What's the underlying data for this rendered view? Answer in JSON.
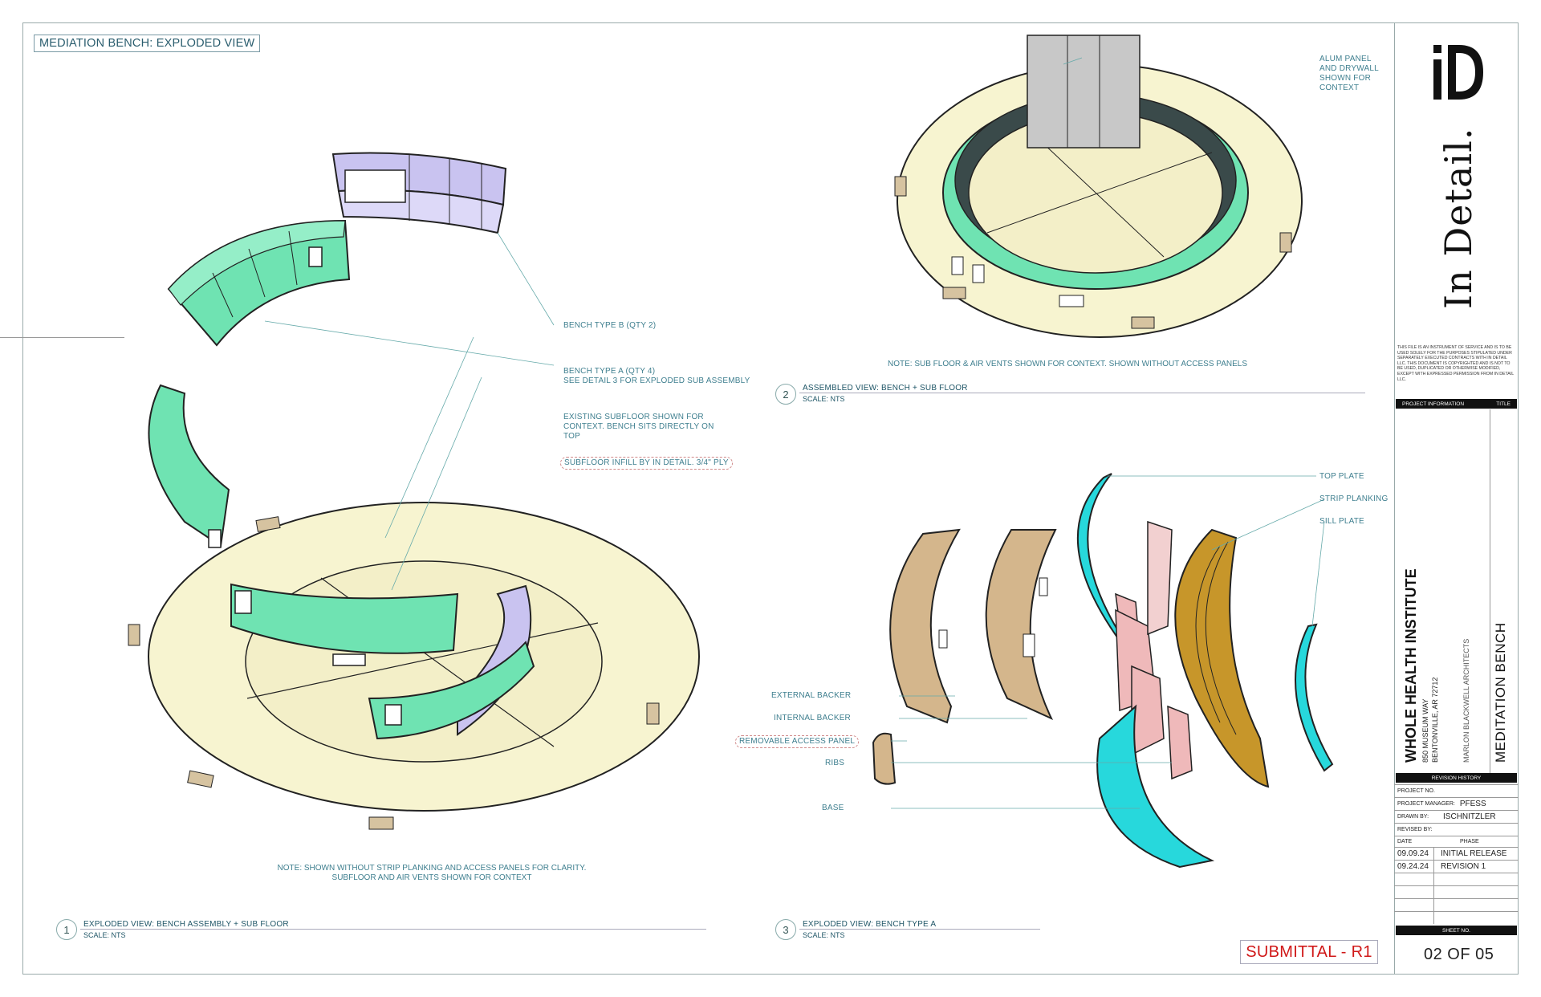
{
  "sheet_title": "MEDIATION BENCH: EXPLODED VIEW",
  "view1": {
    "labels": {
      "bench_b": "BENCH TYPE B (QTY 2)",
      "bench_a_1": "BENCH TYPE A (QTY 4)",
      "bench_a_2": "SEE DETAIL 3 FOR EXPLODED SUB ASSEMBLY",
      "subfloor_1": "EXISTING SUBFLOOR SHOWN FOR",
      "subfloor_2": "CONTEXT. BENCH SITS DIRECTLY ON",
      "subfloor_3": "TOP",
      "infill": "SUBFLOOR INFILL BY IN DETAIL. 3/4\" PLY"
    },
    "note_1": "NOTE: SHOWN WITHOUT STRIP PLANKING AND ACCESS PANELS FOR CLARITY.",
    "note_2": "SUBFLOOR AND AIR VENTS SHOWN FOR CONTEXT",
    "number": "1",
    "title": "EXPLODED VIEW: BENCH ASSEMBLY + SUB FLOOR",
    "scale": "SCALE: NTS"
  },
  "view2": {
    "labels": {
      "alum_1": "ALUM PANEL",
      "alum_2": "AND DRYWALL",
      "alum_3": "SHOWN FOR",
      "alum_4": "CONTEXT"
    },
    "note": "NOTE: SUB FLOOR & AIR VENTS SHOWN FOR CONTEXT. SHOWN WITHOUT ACCESS PANELS",
    "number": "2",
    "title": "ASSEMBLED VIEW: BENCH + SUB FLOOR",
    "scale": "SCALE: NTS"
  },
  "view3": {
    "labels": {
      "top_plate": "TOP PLATE",
      "strip_planking": "STRIP PLANKING",
      "sill_plate": "SILL PLATE",
      "external_backer": "EXTERNAL BACKER",
      "internal_backer": "INTERNAL BACKER",
      "removable_panel": "REMOVABLE ACCESS PANEL",
      "ribs": "RIBS",
      "base": "BASE"
    },
    "number": "3",
    "title": "EXPLODED VIEW: BENCH TYPE A",
    "scale": "SCALE: NTS"
  },
  "title_block": {
    "logo_text": "In Detail.",
    "disclaimer": "THIS FILE IS AN INSTRUMENT OF SERVICE AND IS TO BE USED SOLELY FOR THE PURPOSES STIPULATED UNDER SEPARATELY EXECUTED CONTRACTS WITH IN DETAIL LLC. THIS DOCUMENT IS COPYRIGHTED AND IS NOT TO BE USED, DUPLICATED OR OTHERWISE MODIFIED, EXCEPT WITH EXPRESSED PERMISSION FROM IN DETAIL LLC.",
    "project_info_header": "PROJECT INFORMATION",
    "title_header": "TITLE",
    "project_name": "WHOLE HEALTH INSTITUTE",
    "address_1": "850 MUSEUM WAY",
    "address_2": "BENTONVILLE, AR 72712",
    "architect": "MARLON BLACKWELL ARCHITECTS",
    "sheet_name": "MEDITATION BENCH",
    "revision_history_header": "REVISION HISTORY",
    "project_no_label": "PROJECT NO.",
    "project_manager_label": "PROJECT MANAGER:",
    "project_manager": "PFESS",
    "drawn_by_label": "DRAWN BY:",
    "drawn_by": "ISCHNITZLER",
    "revised_by_label": "REVISED BY:",
    "date_header": "DATE",
    "phase_header": "PHASE",
    "revisions": [
      {
        "date": "09.09.24",
        "phase": "INITIAL RELEASE"
      },
      {
        "date": "09.24.24",
        "phase": "REVISION 1"
      }
    ],
    "sheet_no_header": "SHEET NO.",
    "sheet_no": "02 OF 05"
  },
  "submittal": "SUBMITTAL - R1",
  "colors": {
    "bench_green": "#6fe3b2",
    "bench_lavender": "#c9c3f0",
    "floor_cream": "#f7f4d0",
    "backer_tan": "#d4b68c",
    "plate_cyan": "#27d8dc",
    "rib_pink": "#efb9ba",
    "planking_gold": "#c7962a",
    "submittal_red": "#d01818"
  }
}
